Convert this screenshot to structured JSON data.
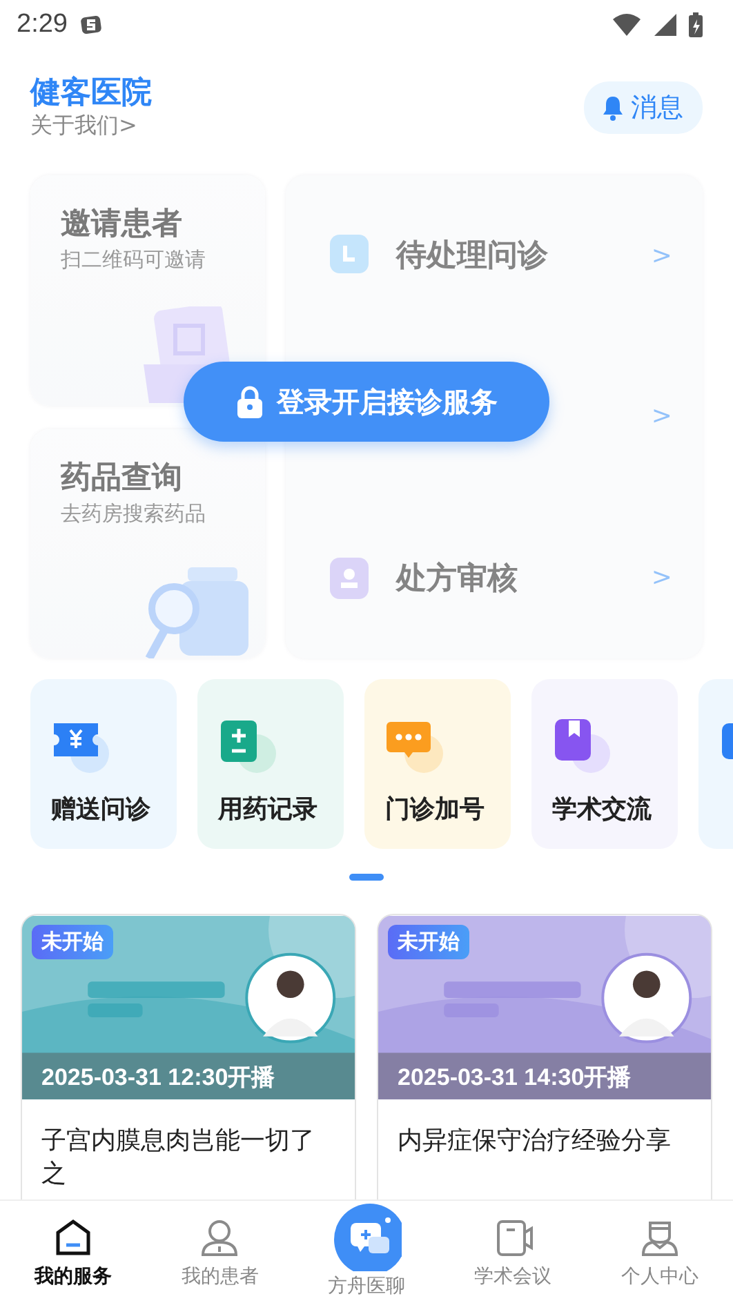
{
  "status_bar": {
    "time": "2:29"
  },
  "header": {
    "title": "健客医院",
    "about": "关于我们>",
    "message_button": "消息"
  },
  "services": {
    "locked": true,
    "login_button": "登录开启接诊服务",
    "side_cards": [
      {
        "kind": "invite",
        "title": "邀请患者",
        "subtitle": "扫二维码可邀请"
      },
      {
        "kind": "drug",
        "title": "药品查询",
        "subtitle": "去药房搜索药品"
      }
    ],
    "tasks": [
      {
        "kind": "clock",
        "label": "待处理问诊",
        "arrow": ">"
      },
      {
        "kind": "hidden",
        "arrow": ">"
      },
      {
        "kind": "stamp",
        "label": "处方审核",
        "arrow": ">"
      }
    ]
  },
  "quick_items": [
    {
      "kind": "ticket",
      "label": "赠送问诊",
      "color": "#eef7fe"
    },
    {
      "kind": "plusminus",
      "label": "用药记录",
      "color": "#ecf8f5"
    },
    {
      "kind": "chat",
      "label": "门诊加号",
      "color": "#fef8e6"
    },
    {
      "kind": "book",
      "label": "学术交流",
      "color": "#f6f5fd"
    },
    {
      "kind": "partial",
      "color": "#eef7fe"
    }
  ],
  "lives": [
    {
      "badge": "未开始",
      "time": "2025-03-31 12:30开播",
      "title": "子宫内膜息肉岂能一切了之",
      "color": "#3aa7b5"
    },
    {
      "badge": "未开始",
      "time": "2025-03-31 14:30开播",
      "title": "内异症保守治疗经验分享",
      "color": "#9b8fe0"
    }
  ],
  "tabs": [
    {
      "kind": "home",
      "label": "我的服务",
      "selected": true
    },
    {
      "kind": "person",
      "label": "我的患者",
      "selected": false
    },
    {
      "kind": "fab",
      "label": "方舟医聊",
      "selected": false
    },
    {
      "kind": "video",
      "label": "学术会议",
      "selected": false
    },
    {
      "kind": "doctor",
      "label": "个人中心",
      "selected": false
    }
  ]
}
